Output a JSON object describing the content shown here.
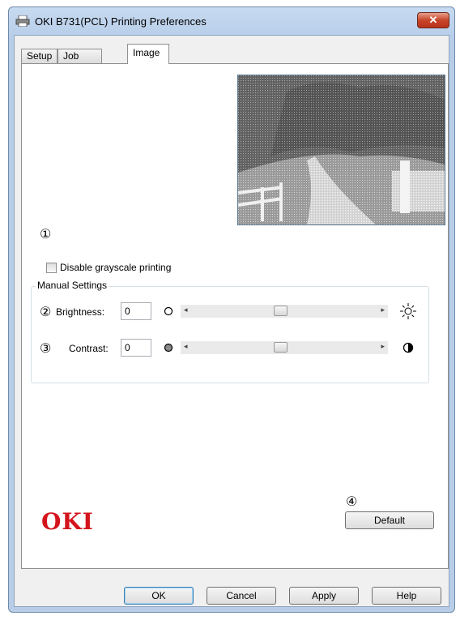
{
  "window": {
    "title": "OKI B731(PCL) Printing Preferences",
    "close_label": "✕",
    "icons": {
      "app": "printer-icon",
      "close": "close-icon"
    }
  },
  "tabs": [
    {
      "label": "Setup",
      "active": false
    },
    {
      "label": "Job Options",
      "active": false
    },
    {
      "label": "Image",
      "active": true
    }
  ],
  "image_tab": {
    "markers": [
      "①",
      "②",
      "③",
      "④"
    ],
    "disable_grayscale": {
      "label": "Disable grayscale printing",
      "checked": false
    },
    "manual_settings": {
      "label": "Manual Settings",
      "brightness": {
        "label": "Brightness:",
        "value": "0",
        "slider_fraction": 0.5,
        "icons": {
          "low": "circle-outline-icon",
          "high": "sun-icon"
        }
      },
      "contrast": {
        "label": "Contrast:",
        "value": "0",
        "slider_fraction": 0.5,
        "icons": {
          "low": "gray-circle-icon",
          "high": "half-circle-icon"
        }
      }
    },
    "logo": "OKI",
    "default_button": "Default"
  },
  "footer": {
    "ok": "OK",
    "cancel": "Cancel",
    "apply": "Apply",
    "help": "Help"
  }
}
